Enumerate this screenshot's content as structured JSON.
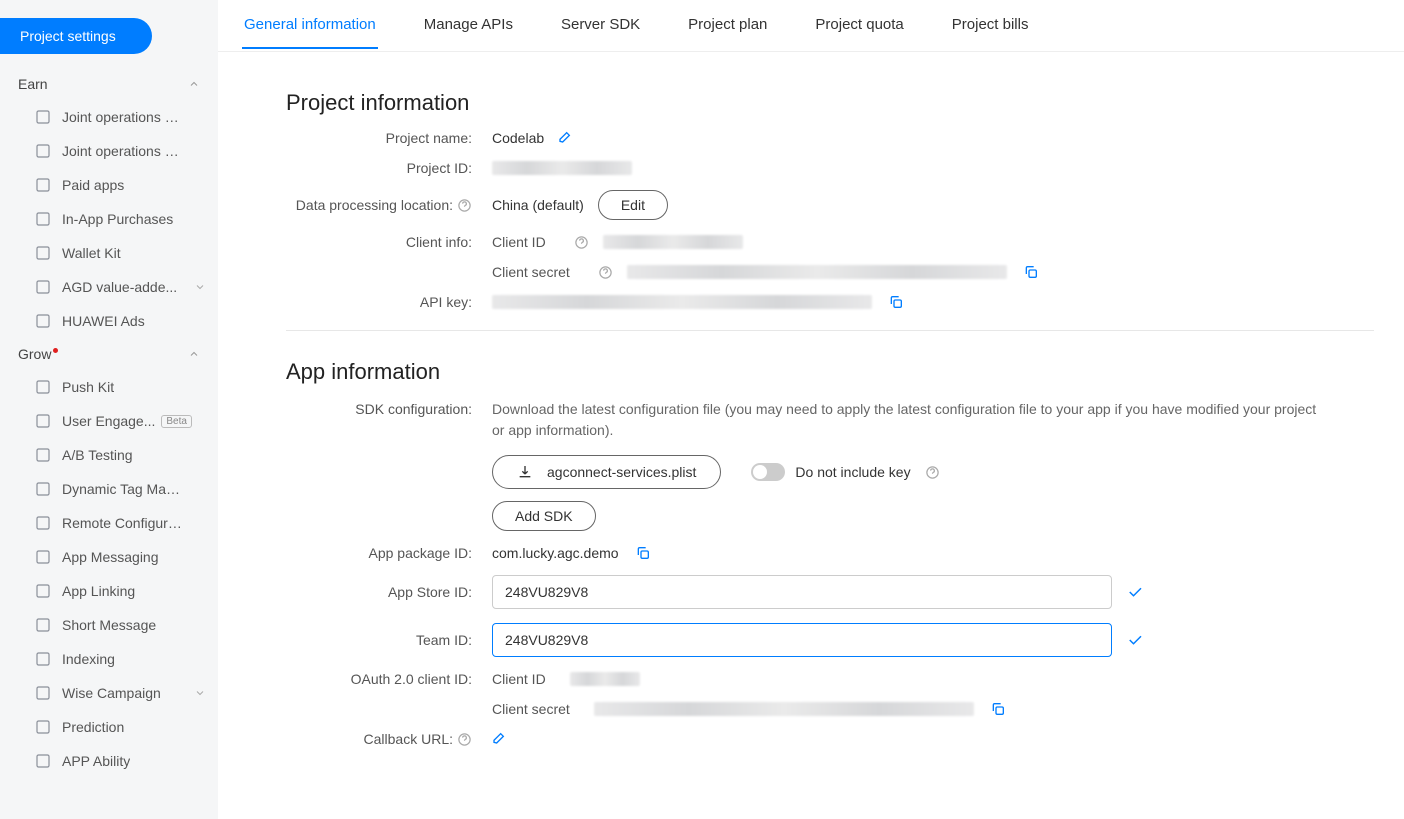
{
  "sidebar": {
    "settings_button": "Project settings",
    "groups": [
      {
        "title": "Earn",
        "items": [
          {
            "label": "Joint operations – a..."
          },
          {
            "label": "Joint operations – g..."
          },
          {
            "label": "Paid apps"
          },
          {
            "label": "In-App Purchases"
          },
          {
            "label": "Wallet Kit"
          },
          {
            "label": "AGD value-adde...",
            "expandable": true
          },
          {
            "label": "HUAWEI Ads"
          }
        ]
      },
      {
        "title": "Grow",
        "hasDot": true,
        "items": [
          {
            "label": "Push Kit"
          },
          {
            "label": "User Engage...",
            "badge": "Beta"
          },
          {
            "label": "A/B Testing"
          },
          {
            "label": "Dynamic Tag Manag..."
          },
          {
            "label": "Remote Configurati..."
          },
          {
            "label": "App Messaging"
          },
          {
            "label": "App Linking"
          },
          {
            "label": "Short Message"
          },
          {
            "label": "Indexing"
          },
          {
            "label": "Wise Campaign",
            "expandable": true
          },
          {
            "label": "Prediction"
          },
          {
            "label": "APP Ability"
          }
        ]
      }
    ]
  },
  "tabs": [
    "General information",
    "Manage APIs",
    "Server SDK",
    "Project plan",
    "Project quota",
    "Project bills"
  ],
  "project_info": {
    "title": "Project information",
    "labels": {
      "name": "Project name:",
      "id": "Project ID:",
      "location": "Data processing location:",
      "client": "Client info:",
      "apikey": "API key:"
    },
    "name": "Codelab",
    "location": "China (default)",
    "edit_btn": "Edit",
    "client_id_lbl": "Client ID",
    "client_secret_lbl": "Client secret"
  },
  "app_info": {
    "title": "App information",
    "labels": {
      "sdk": "SDK configuration:",
      "pkg": "App package ID:",
      "store": "App Store ID:",
      "team": "Team ID:",
      "oauth": "OAuth 2.0 client ID:",
      "callback": "Callback URL:"
    },
    "sdk_desc": "Download the latest configuration file (you may need to apply the latest configuration file to your app if you have modified your project or app information).",
    "download_file": "agconnect-services.plist",
    "toggle_label": "Do not include key",
    "add_sdk_btn": "Add SDK",
    "pkg": "com.lucky.agc.demo",
    "store_id": "248VU829V8",
    "team_id": "248VU829V8",
    "oauth_client_id_lbl": "Client ID",
    "oauth_client_secret_lbl": "Client secret"
  }
}
